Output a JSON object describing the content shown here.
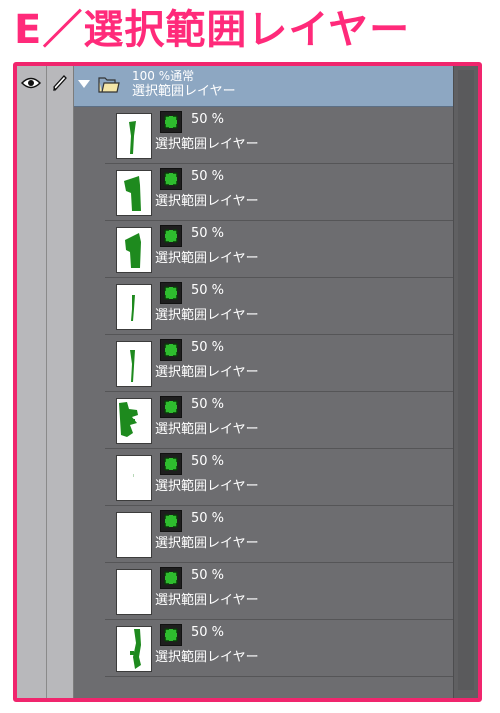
{
  "heading": "E／選択範囲レイヤー",
  "header_icons": [
    "eye-icon",
    "pen-icon"
  ],
  "folder": {
    "opacity_mode": "100 %通常",
    "name": "選択範囲レイヤー",
    "expanded": true,
    "row_color": "#8da7c2"
  },
  "accent_color": "#f0256d",
  "mask_color": "#2ebd2e",
  "layers": [
    {
      "opacity": "50 %",
      "name": "選択範囲レイヤー"
    },
    {
      "opacity": "50 %",
      "name": "選択範囲レイヤー"
    },
    {
      "opacity": "50 %",
      "name": "選択範囲レイヤー"
    },
    {
      "opacity": "50 %",
      "name": "選択範囲レイヤー"
    },
    {
      "opacity": "50 %",
      "name": "選択範囲レイヤー"
    },
    {
      "opacity": "50 %",
      "name": "選択範囲レイヤー"
    },
    {
      "opacity": "50 %",
      "name": "選択範囲レイヤー"
    },
    {
      "opacity": "50 %",
      "name": "選択範囲レイヤー"
    },
    {
      "opacity": "50 %",
      "name": "選択範囲レイヤー"
    },
    {
      "opacity": "50 %",
      "name": "選択範囲レイヤー"
    }
  ]
}
